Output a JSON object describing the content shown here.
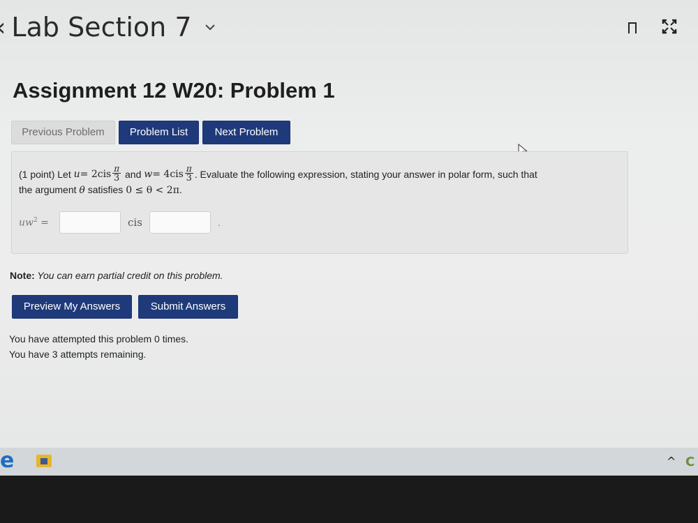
{
  "header": {
    "back_chevron": "‹",
    "title": "Lab Section 7",
    "dropdown_chevron": "⌄",
    "bookmark_icon": "bookmark-icon",
    "expand_icon": "expand-icon"
  },
  "problem": {
    "title": "Assignment 12 W20: Problem 1",
    "nav": {
      "previous": "Previous Problem",
      "list": "Problem List",
      "next": "Next Problem"
    },
    "question": {
      "points": "(1 point) Let",
      "u_var": "u",
      "eq1": " = 2cis",
      "frac1_num": "π",
      "frac1_den": "3",
      "and_text": " and ",
      "w_var": "w",
      "eq2": " = 4cis",
      "frac2_num": "π",
      "frac2_den": "3",
      "rest": ". Evaluate the following expression, stating your answer in polar form, such that",
      "line2_text": "the argument ",
      "theta": "θ",
      "line2_mid": " satisfies ",
      "inequality": "0 ≤ θ < 2π",
      "line2_end": "."
    },
    "answer": {
      "label": "uw",
      "exponent": "2",
      "equals": " =",
      "modulus_value": "",
      "cis_label": "cis",
      "argument_value": "",
      "trailing": "."
    }
  },
  "note": {
    "bold": "Note:",
    "text": " You can earn partial credit on this problem."
  },
  "actions": {
    "preview": "Preview My Answers",
    "submit": "Submit Answers"
  },
  "status": {
    "attempted": "You have attempted this problem 0 times.",
    "remaining": "You have 3 attempts remaining."
  },
  "taskbar": {
    "edge_glyph": "e",
    "tray_chevron": "^",
    "tray_app": "C"
  },
  "colors": {
    "primary_button": "#1f3a7a",
    "secondary_button": "#dcdcdc",
    "page_background": "#ececec"
  }
}
